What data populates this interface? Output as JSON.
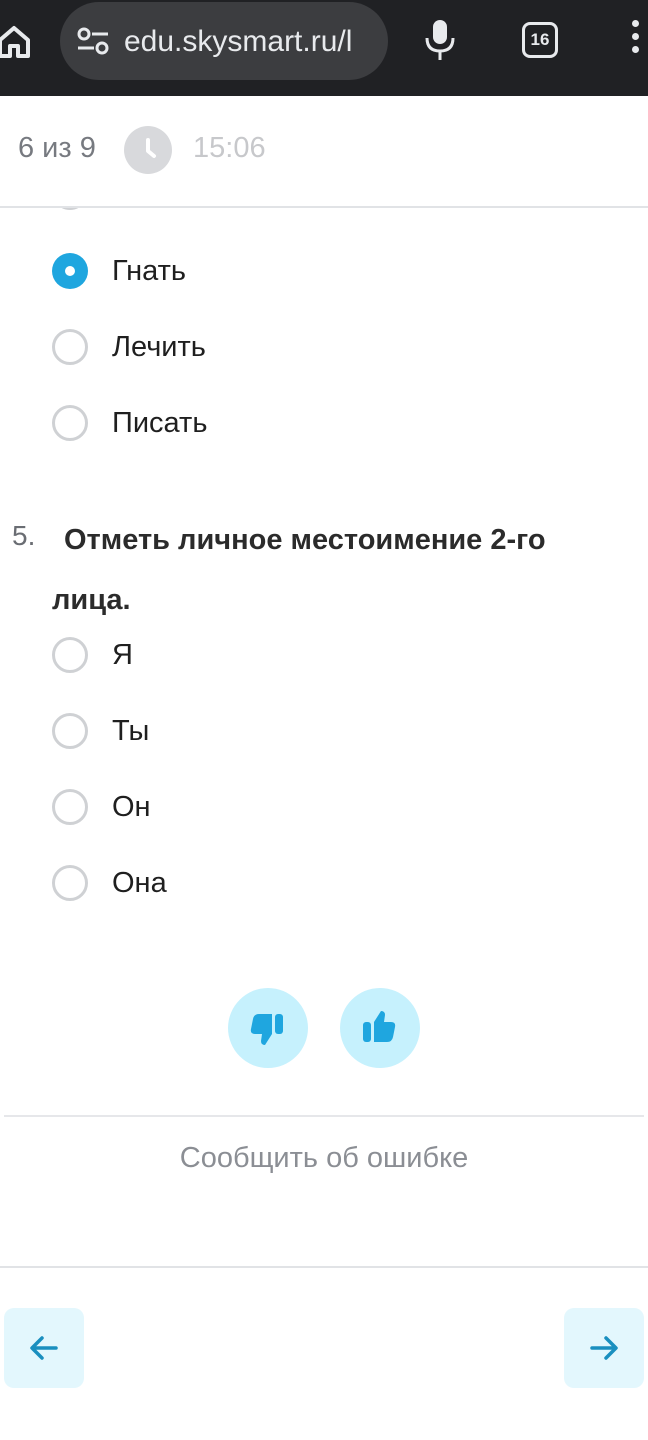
{
  "browser": {
    "url": "edu.skysmart.ru/l",
    "tab_count": "16",
    "icons": [
      "home-icon",
      "site-settings-icon",
      "mic-icon",
      "tabs-icon",
      "more-icon"
    ]
  },
  "progress": {
    "text": "6 из 9",
    "timer": "15:06"
  },
  "prev_question": {
    "options": [
      {
        "label": "Гнать",
        "selected": true
      },
      {
        "label": "Лечить",
        "selected": false
      },
      {
        "label": "Писать",
        "selected": false
      }
    ]
  },
  "question5": {
    "number": "5.",
    "text": "Отметь личное местоимение 2-го лица.",
    "options": [
      {
        "label": "Я"
      },
      {
        "label": "Ты"
      },
      {
        "label": "Он"
      },
      {
        "label": "Она"
      }
    ]
  },
  "feedback": {
    "icons": [
      "thumbs-down-icon",
      "thumbs-up-icon"
    ]
  },
  "report_label": "Сообщить об ошибке",
  "colors": {
    "accent": "#1fa6df",
    "feedback_bg": "#c6f1fd",
    "nav_bg": "#e3f7fd",
    "toolbar_bg": "#202124"
  }
}
